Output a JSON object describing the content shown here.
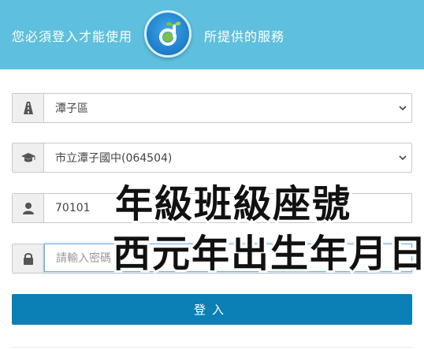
{
  "header": {
    "left_text": "您必須登入才能使用",
    "right_text": "所提供的服務",
    "logo_icon": "sprout-logo-icon",
    "bg_color": "#5ec0de"
  },
  "form": {
    "district": {
      "icon": "road-icon",
      "value": "潭子區"
    },
    "school": {
      "icon": "graduation-cap-icon",
      "value": "市立潭子國中(064504)"
    },
    "student_id": {
      "icon": "user-icon",
      "value": "70101"
    },
    "password": {
      "icon": "lock-icon",
      "placeholder": "請輸入密碼"
    },
    "login_label": "登入",
    "button_color": "#0a80b6"
  },
  "overlay": {
    "line1": "年級班級座號",
    "line2": "西元年出生年月日"
  }
}
